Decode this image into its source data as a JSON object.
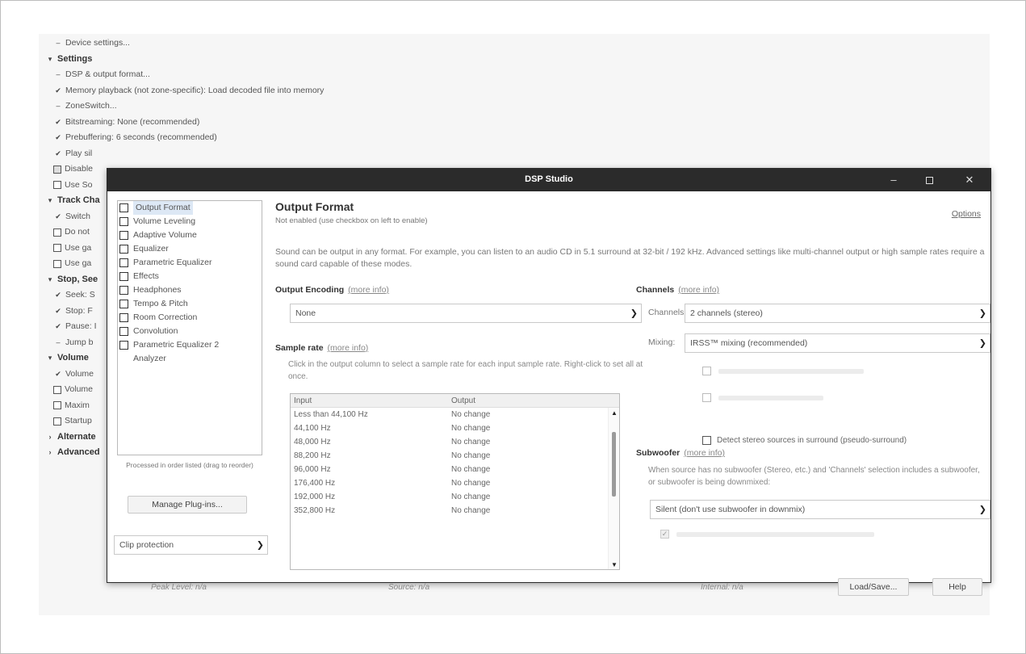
{
  "tree": {
    "rows": [
      {
        "marker": "dash",
        "label": "Device settings...",
        "level": 1
      },
      {
        "marker": "collapse",
        "label": "Settings",
        "level": 0
      },
      {
        "marker": "dash",
        "label": "DSP & output format...",
        "level": 1
      },
      {
        "marker": "check",
        "label": "Memory playback (not zone-specific): Load decoded file into memory",
        "level": 1
      },
      {
        "marker": "dash",
        "label": "ZoneSwitch...",
        "level": 1
      },
      {
        "marker": "check",
        "label": "Bitstreaming: None (recommended)",
        "level": 1
      },
      {
        "marker": "check",
        "label": "Prebuffering: 6 seconds (recommended)",
        "level": 1
      },
      {
        "marker": "check",
        "label": "Play sil",
        "level": 1
      },
      {
        "marker": "box-on",
        "label": "Disable",
        "level": 1
      },
      {
        "marker": "box",
        "label": "Use So",
        "level": 1
      },
      {
        "marker": "collapse",
        "label": "Track Cha",
        "level": 0
      },
      {
        "marker": "check",
        "label": "Switch",
        "level": 1
      },
      {
        "marker": "box",
        "label": "Do not",
        "level": 1
      },
      {
        "marker": "box",
        "label": "Use ga",
        "level": 1
      },
      {
        "marker": "box",
        "label": "Use ga",
        "level": 1
      },
      {
        "marker": "collapse",
        "label": "Stop, See",
        "level": 0
      },
      {
        "marker": "check",
        "label": "Seek: S",
        "level": 1
      },
      {
        "marker": "check",
        "label": "Stop: F",
        "level": 1
      },
      {
        "marker": "check",
        "label": "Pause: I",
        "level": 1
      },
      {
        "marker": "dash",
        "label": "Jump b",
        "level": 1
      },
      {
        "marker": "collapse",
        "label": "Volume",
        "level": 0
      },
      {
        "marker": "check",
        "label": "Volume",
        "level": 1
      },
      {
        "marker": "box",
        "label": "Volume",
        "level": 1
      },
      {
        "marker": "box",
        "label": "Maxim",
        "level": 1
      },
      {
        "marker": "box",
        "label": "Startup",
        "level": 1
      },
      {
        "marker": "expand",
        "label": "Alternate",
        "level": 0
      },
      {
        "marker": "expand",
        "label": "Advanced",
        "level": 0
      }
    ]
  },
  "dialog": {
    "title": "DSP Studio",
    "controls": {
      "minimize": "–",
      "close": "✕"
    }
  },
  "plugins": {
    "items": [
      {
        "label": "Output Format",
        "checkbox": true,
        "selected": true
      },
      {
        "label": "Volume Leveling",
        "checkbox": true
      },
      {
        "label": "Adaptive Volume",
        "checkbox": true
      },
      {
        "label": "Equalizer",
        "checkbox": true
      },
      {
        "label": "Parametric Equalizer",
        "checkbox": true
      },
      {
        "label": "Effects",
        "checkbox": true
      },
      {
        "label": "Headphones",
        "checkbox": true
      },
      {
        "label": "Tempo & Pitch",
        "checkbox": true
      },
      {
        "label": "Room Correction",
        "checkbox": true
      },
      {
        "label": "Convolution",
        "checkbox": true
      },
      {
        "label": "Parametric Equalizer 2",
        "checkbox": true
      },
      {
        "label": "Analyzer",
        "checkbox": false
      }
    ],
    "note": "Processed in order listed (drag to reorder)",
    "manage_label": "Manage Plug-ins...",
    "clip_value": "Clip protection"
  },
  "main": {
    "title": "Output Format",
    "subtitle": "Not enabled (use checkbox on left to enable)",
    "options_link": "Options",
    "description": "Sound can be output in any format. For example, you can listen to an audio CD in 5.1 surround at 32-bit / 192 kHz. Advanced settings like multi-channel output or high sample rates require a sound card capable of these modes.",
    "more_info": "(more info)",
    "encoding": {
      "label": "Output Encoding",
      "value": "None"
    },
    "sample_rate": {
      "label": "Sample rate",
      "description": "Click in the output column to select a sample rate for each input sample rate. Right-click to set all at once.",
      "columns": [
        "Input",
        "Output"
      ],
      "rows": [
        {
          "input": "Less than 44,100 Hz",
          "output": "No change"
        },
        {
          "input": "44,100 Hz",
          "output": "No change"
        },
        {
          "input": "48,000 Hz",
          "output": "No change"
        },
        {
          "input": "88,200 Hz",
          "output": "No change"
        },
        {
          "input": "96,000 Hz",
          "output": "No change"
        },
        {
          "input": "176,400 Hz",
          "output": "No change"
        },
        {
          "input": "192,000 Hz",
          "output": "No change"
        },
        {
          "input": "352,800 Hz",
          "output": "No change"
        }
      ]
    },
    "channels": {
      "label": "Channels",
      "channels_label": "Channels:",
      "channels_value": "2 channels (stereo)",
      "mixing_label": "Mixing:",
      "mixing_value": "IRSS™ mixing (recommended)",
      "detect_label": "Detect stereo sources in surround (pseudo-surround)"
    },
    "subwoofer": {
      "label": "Subwoofer",
      "description": "When source has no subwoofer (Stereo, etc.) and 'Channels' selection includes a subwoofer, or subwoofer is being downmixed:",
      "value": "Silent (don't use subwoofer in downmix)"
    }
  },
  "footer": {
    "peak": "Peak Level: n/a",
    "source": "Source: n/a",
    "internal": "Internal: n/a",
    "load_save": "Load/Save...",
    "help": "Help"
  },
  "colors": {
    "titlebar": "#2b2b2b",
    "selection": "#dde8f5"
  }
}
